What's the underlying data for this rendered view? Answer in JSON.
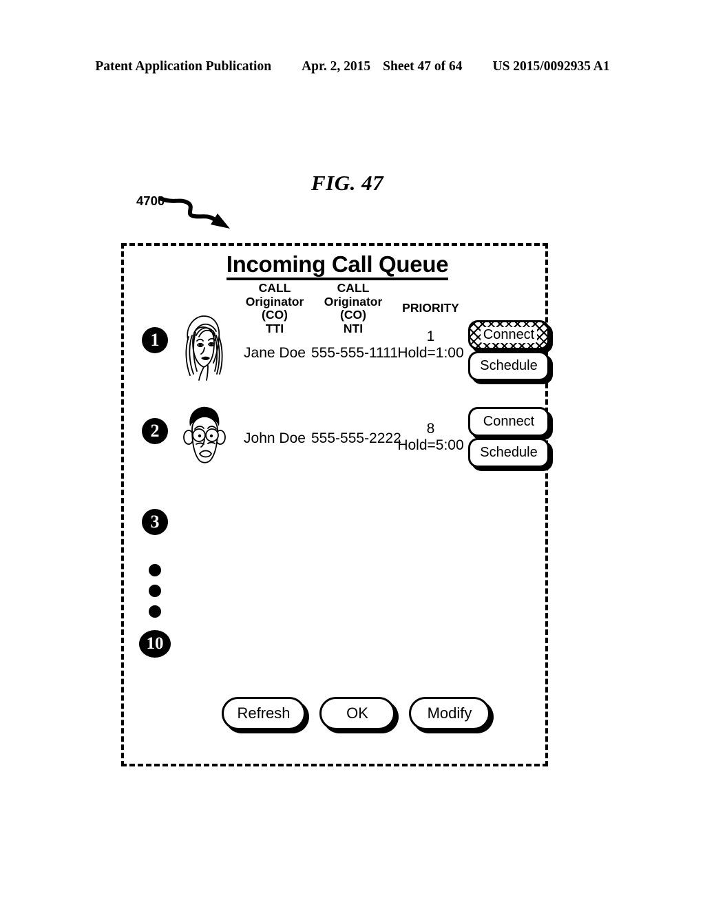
{
  "page_header": {
    "publication": "Patent Application Publication",
    "date": "Apr. 2, 2015",
    "sheet": "Sheet 47 of 64",
    "patent_number": "US 2015/0092935 A1"
  },
  "figure": {
    "label": "FIG. 47",
    "reference_numeral": "4700",
    "lead_line_icon": "squiggly-arrow-icon"
  },
  "panel": {
    "title": "Incoming Call Queue",
    "columns": [
      {
        "key": "tti",
        "lines": [
          "CALL",
          "Originator",
          "(CO)",
          "TTI"
        ]
      },
      {
        "key": "nti",
        "lines": [
          "CALL",
          "Originator",
          "(CO)",
          "NTI"
        ]
      },
      {
        "key": "prio",
        "lines": [
          "PRIORITY"
        ]
      }
    ],
    "column_header_tti_l1": "CALL",
    "column_header_tti_l2": "Originator",
    "column_header_tti_l3": "(CO)",
    "column_header_tti_l4": "TTI",
    "column_header_nti_l1": "CALL",
    "column_header_nti_l2": "Originator",
    "column_header_nti_l3": "(CO)",
    "column_header_nti_l4": "NTI",
    "column_header_priority": "PRIORITY",
    "rows": [
      {
        "badge": "1",
        "avatar": "woman-face-icon",
        "tti": "Jane Doe",
        "nti": "555-555-1111",
        "priority": "1",
        "hold": "Hold=1:00",
        "connect_label": "Connect",
        "schedule_label": "Schedule",
        "connect_selected": true,
        "schedule_selected": false
      },
      {
        "badge": "2",
        "avatar": "man-face-icon",
        "tti": "John Doe",
        "nti": "555-555-2222",
        "priority": "8",
        "hold": "Hold=5:00",
        "connect_label": "Connect",
        "schedule_label": "Schedule",
        "connect_selected": false,
        "schedule_selected": false
      }
    ],
    "empty_slots": {
      "third": "3",
      "ellipsis_icon": "vertical-ellipsis-icon",
      "last": "10"
    },
    "footer_buttons": {
      "refresh": "Refresh",
      "ok": "OK",
      "modify": "Modify",
      "ok_selected": true
    }
  },
  "colors": {
    "ink": "#000000",
    "paper": "#ffffff"
  }
}
